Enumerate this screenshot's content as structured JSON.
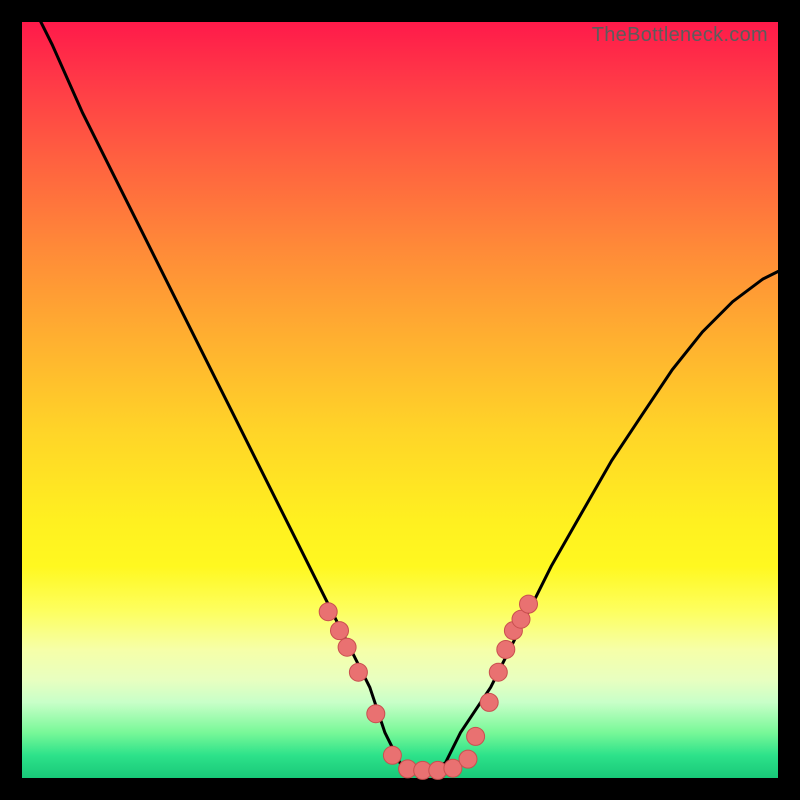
{
  "watermark": "TheBottleneck.com",
  "colors": {
    "background": "#000000",
    "curve": "#000000",
    "marker_fill": "#e97171",
    "marker_stroke": "#c94f4f"
  },
  "chart_data": {
    "type": "line",
    "title": "",
    "xlabel": "",
    "ylabel": "",
    "xlim": [
      0,
      100
    ],
    "ylim": [
      0,
      100
    ],
    "series": [
      {
        "name": "bottleneck-curve",
        "x": [
          0,
          4,
          8,
          12,
          16,
          20,
          24,
          28,
          32,
          36,
          40,
          44,
          46,
          48,
          50,
          52,
          54,
          56,
          58,
          62,
          66,
          70,
          74,
          78,
          82,
          86,
          90,
          94,
          98,
          100
        ],
        "values": [
          105,
          97,
          88,
          80,
          72,
          64,
          56,
          48,
          40,
          32,
          24,
          16,
          12,
          6,
          2,
          1,
          1,
          2,
          6,
          12,
          20,
          28,
          35,
          42,
          48,
          54,
          59,
          63,
          66,
          67
        ]
      }
    ],
    "markers": {
      "name": "highlighted-points",
      "x": [
        40.5,
        42.0,
        43.0,
        44.5,
        46.8,
        49.0,
        51.0,
        53.0,
        55.0,
        57.0,
        59.0,
        60.0,
        61.8,
        63.0,
        64.0,
        65.0,
        66.0,
        67.0
      ],
      "values": [
        22.0,
        19.5,
        17.3,
        14.0,
        8.5,
        3.0,
        1.2,
        1.0,
        1.0,
        1.3,
        2.5,
        5.5,
        10.0,
        14.0,
        17.0,
        19.5,
        21.0,
        23.0
      ]
    }
  }
}
